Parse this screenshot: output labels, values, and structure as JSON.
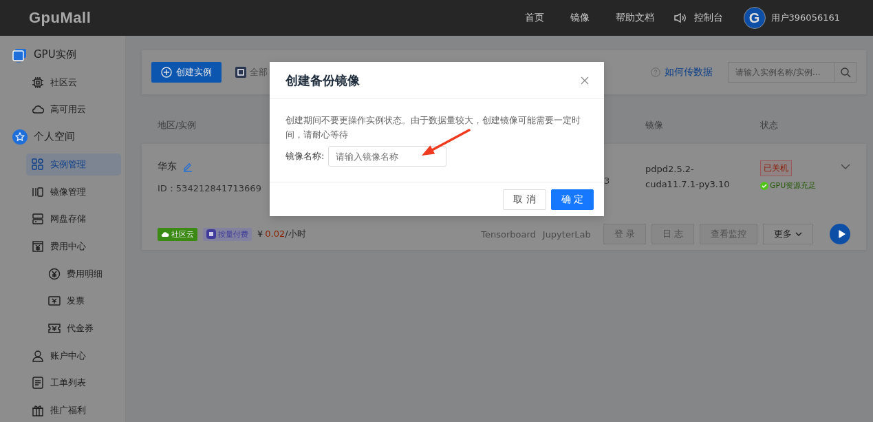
{
  "header": {
    "logo": "GpuMall",
    "nav": [
      {
        "label": "首页"
      },
      {
        "label": "镜像"
      },
      {
        "label": "帮助文档"
      },
      {
        "label": "控制台"
      }
    ],
    "avatar_letter": "G",
    "user": "用户396056161"
  },
  "sidebar": {
    "items": [
      {
        "label": "GPU实例",
        "kind": "group",
        "selected": false,
        "children": [
          {
            "label": "社区云",
            "kind": "item",
            "selected": false
          },
          {
            "label": "高可用云",
            "kind": "item",
            "selected": false
          }
        ]
      },
      {
        "label": "个人空间",
        "kind": "group",
        "selected": false,
        "children": [
          {
            "label": "实例管理",
            "kind": "item",
            "selected": true
          },
          {
            "label": "镜像管理",
            "kind": "item",
            "selected": false
          },
          {
            "label": "网盘存储",
            "kind": "item",
            "selected": false
          },
          {
            "label": "费用中心",
            "kind": "item",
            "selected": false,
            "children": [
              {
                "label": "费用明细",
                "kind": "item",
                "selected": false
              },
              {
                "label": "发票",
                "kind": "item",
                "selected": false
              },
              {
                "label": "代金券",
                "kind": "item",
                "selected": false
              }
            ]
          },
          {
            "label": "账户中心",
            "kind": "item",
            "selected": false
          },
          {
            "label": "工单列表",
            "kind": "item",
            "selected": false
          },
          {
            "label": "推广福利",
            "kind": "item",
            "selected": false
          }
        ]
      }
    ]
  },
  "toolbar": {
    "create_button": "创建实例",
    "filter": "全部",
    "help_link": "如何传数据",
    "search": {
      "placeholder": "请输入实例名称/实例..."
    }
  },
  "table": {
    "columns": [
      {
        "label": "地区/实例"
      },
      {
        "label": "镜像"
      },
      {
        "label": "状态"
      }
    ],
    "rows": [
      {
        "region": "华东",
        "id": "ID：534212841713669",
        "column_2": "3",
        "image": "pdpd2.5.2-cuda11.7.1-py3.10",
        "status": "已关机",
        "gpu_status": "GPU资源充足",
        "tags": [
          {
            "label": "社区云",
            "color": "#3b8a14"
          },
          {
            "label": "按量付费",
            "color": "#3f3b9a"
          }
        ],
        "price_symbol": "¥",
        "price": "0.02",
        "price_unit": "/小时",
        "links": [
          "Tensorboard",
          "JupyterLab"
        ],
        "buttons": [
          {
            "label": "登 录",
            "disabled": true
          },
          {
            "label": "日 志",
            "disabled": true
          },
          {
            "label": "查看监控",
            "disabled": true
          },
          {
            "label": "更多",
            "disabled": false,
            "caret": true
          }
        ]
      }
    ]
  },
  "dialog": {
    "title": "创建备份镜像",
    "message": "创建期间不要更操作实例状态。由于数据量较大，创建镜像可能需要一定时间，请耐心等待",
    "field_label": "镜像名称:",
    "field": {
      "placeholder": "请输入镜像名称"
    },
    "buttons": [
      {
        "label": "取 消",
        "kind": "secondary"
      },
      {
        "label": "确 定",
        "kind": "primary"
      }
    ]
  }
}
